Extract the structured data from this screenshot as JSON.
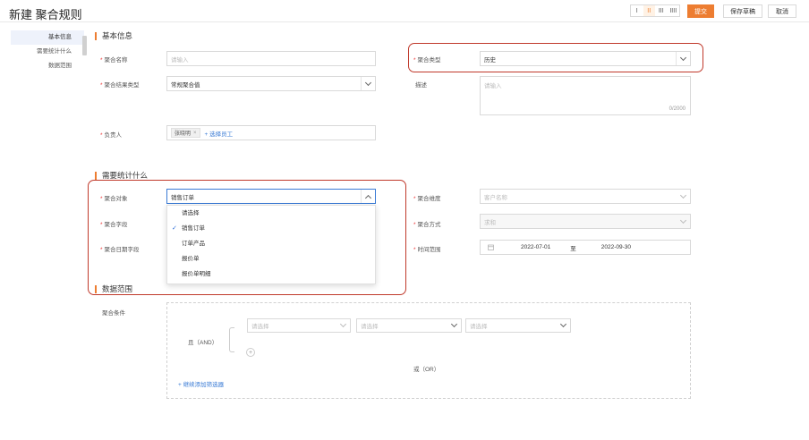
{
  "header": {
    "title": "新建 聚合规则",
    "layout_options": [
      "I",
      "II",
      "III",
      "IIII"
    ],
    "active_layout": 1,
    "submit_label": "提交",
    "save_draft_label": "保存草稿",
    "cancel_label": "取消"
  },
  "sidebar": {
    "items": [
      {
        "label": "基本信息",
        "active": true
      },
      {
        "label": "需要统计什么",
        "active": false
      },
      {
        "label": "数据范围",
        "active": false
      }
    ]
  },
  "basic": {
    "section_title": "基本信息",
    "name_label": "聚合名称",
    "name_placeholder": "请输入",
    "type_label": "聚合类型",
    "type_value": "历史",
    "result_type_label": "聚合结果类型",
    "result_type_value": "常规聚合值",
    "desc_label": "描述",
    "desc_placeholder": "请输入",
    "desc_count": "0/2000",
    "owner_label": "负责人",
    "owner_tag": "张晓明",
    "owner_tag_remove": "×",
    "owner_add_link": "+ 选择员工"
  },
  "stats": {
    "section_title": "需要统计什么",
    "object_label": "聚合对象",
    "object_value": "销售订单",
    "dimension_label": "聚合维度",
    "dimension_placeholder": "客户名称",
    "field_label": "聚合字段",
    "method_label": "聚合方式",
    "method_placeholder": "求和",
    "date_field_label": "聚合日期字段",
    "time_range_label": "时间范围",
    "date_start": "2022-07-01",
    "date_separator": "至",
    "date_end": "2022-09-30",
    "dropdown_options": [
      "请选择",
      "销售订单",
      "订单产品",
      "报价单",
      "报价单明细"
    ],
    "dropdown_selected": 1,
    "check_mark": "✓"
  },
  "range": {
    "section_title": "数据范围",
    "condition_label": "聚合条件",
    "and_label": "且（AND）",
    "or_label": "或（OR）",
    "select_placeholder": "请选择",
    "add_filter_link": "+ 继续添加筛选器",
    "add_symbol": "+"
  },
  "colors": {
    "accent": "#ed7d31",
    "highlight_box": "#c0392b",
    "link": "#3a7bd5"
  }
}
